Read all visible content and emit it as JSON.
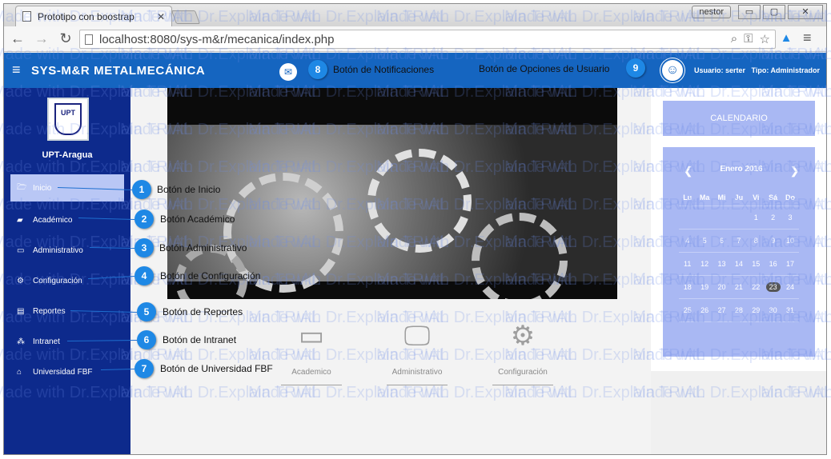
{
  "browser": {
    "tab_title": "Prototipo con boostrap",
    "tab_close": "✕",
    "profile_button": "nestor",
    "minimize": "▭",
    "maximize": "▢",
    "close": "✕",
    "url": "localhost:8080/sys-m&r/mecanica/index.php"
  },
  "appbar": {
    "brand": "SYS-M&R  METALMECÁNICA",
    "user_label": "Usuario: serter",
    "type_label": "Tipo: Administrador"
  },
  "sidebar": {
    "logo_text": "UPT",
    "org_name": "UPT-Aragua",
    "items": [
      {
        "label": "Inicio",
        "icon": "folder-open-icon",
        "glyph": "🗁",
        "active": true
      },
      {
        "label": "Académico",
        "icon": "book-icon",
        "glyph": "▰",
        "active": false
      },
      {
        "label": "Administrativo",
        "icon": "monitor-icon",
        "glyph": "▭",
        "active": false
      },
      {
        "label": "Configuración",
        "icon": "cogs-icon",
        "glyph": "⚙",
        "active": false
      },
      {
        "label": "Reportes",
        "icon": "file-icon",
        "glyph": "▤",
        "active": false
      },
      {
        "label": "Intranet",
        "icon": "sitemap-icon",
        "glyph": "⁂",
        "active": false
      },
      {
        "label": "Universidad FBF",
        "icon": "bank-icon",
        "glyph": "⌂",
        "active": false
      }
    ]
  },
  "shortcuts": [
    {
      "label": "Academico",
      "icon": "wallet-icon"
    },
    {
      "label": "Administrativo",
      "icon": "monitor-icon"
    },
    {
      "label": "Configuración",
      "icon": "gear-icon"
    }
  ],
  "calendar": {
    "title": "CALENDARIO",
    "month": "Enero 2016",
    "prev": "❮",
    "next": "❯",
    "days_of_week": [
      "Lu",
      "Ma",
      "Mi",
      "Ju",
      "Vi",
      "Sá",
      "Do"
    ],
    "weeks": [
      [
        "",
        "",
        "",
        "",
        "1",
        "2",
        "3"
      ],
      [
        "4",
        "5",
        "6",
        "7",
        "8",
        "9",
        "10"
      ],
      [
        "11",
        "12",
        "13",
        "14",
        "15",
        "16",
        "17"
      ],
      [
        "18",
        "19",
        "20",
        "21",
        "22",
        "23",
        "24"
      ],
      [
        "25",
        "26",
        "27",
        "28",
        "29",
        "30",
        "31"
      ]
    ],
    "today": "23"
  },
  "callouts": [
    {
      "num": "1",
      "label": "Botón de Inicio"
    },
    {
      "num": "2",
      "label": "Botón Académico"
    },
    {
      "num": "3",
      "label": "Botón Administrativo"
    },
    {
      "num": "4",
      "label": "Botón de Configuración"
    },
    {
      "num": "5",
      "label": "Botón de Reportes"
    },
    {
      "num": "6",
      "label": "Botón de Intranet"
    },
    {
      "num": "7",
      "label": "Botón de Universidad FBF"
    },
    {
      "num": "8",
      "label": "Botón de Notificaciones"
    },
    {
      "num": "9",
      "label": "Botón de Opciones de Usuario"
    }
  ],
  "watermark": "Made with Dr.Explain TRIAL",
  "colors": {
    "appbar": "#1565c0",
    "sidebar": "#0d2a8c",
    "calendar": "#a9b8f3",
    "callout": "#1e88e5"
  }
}
